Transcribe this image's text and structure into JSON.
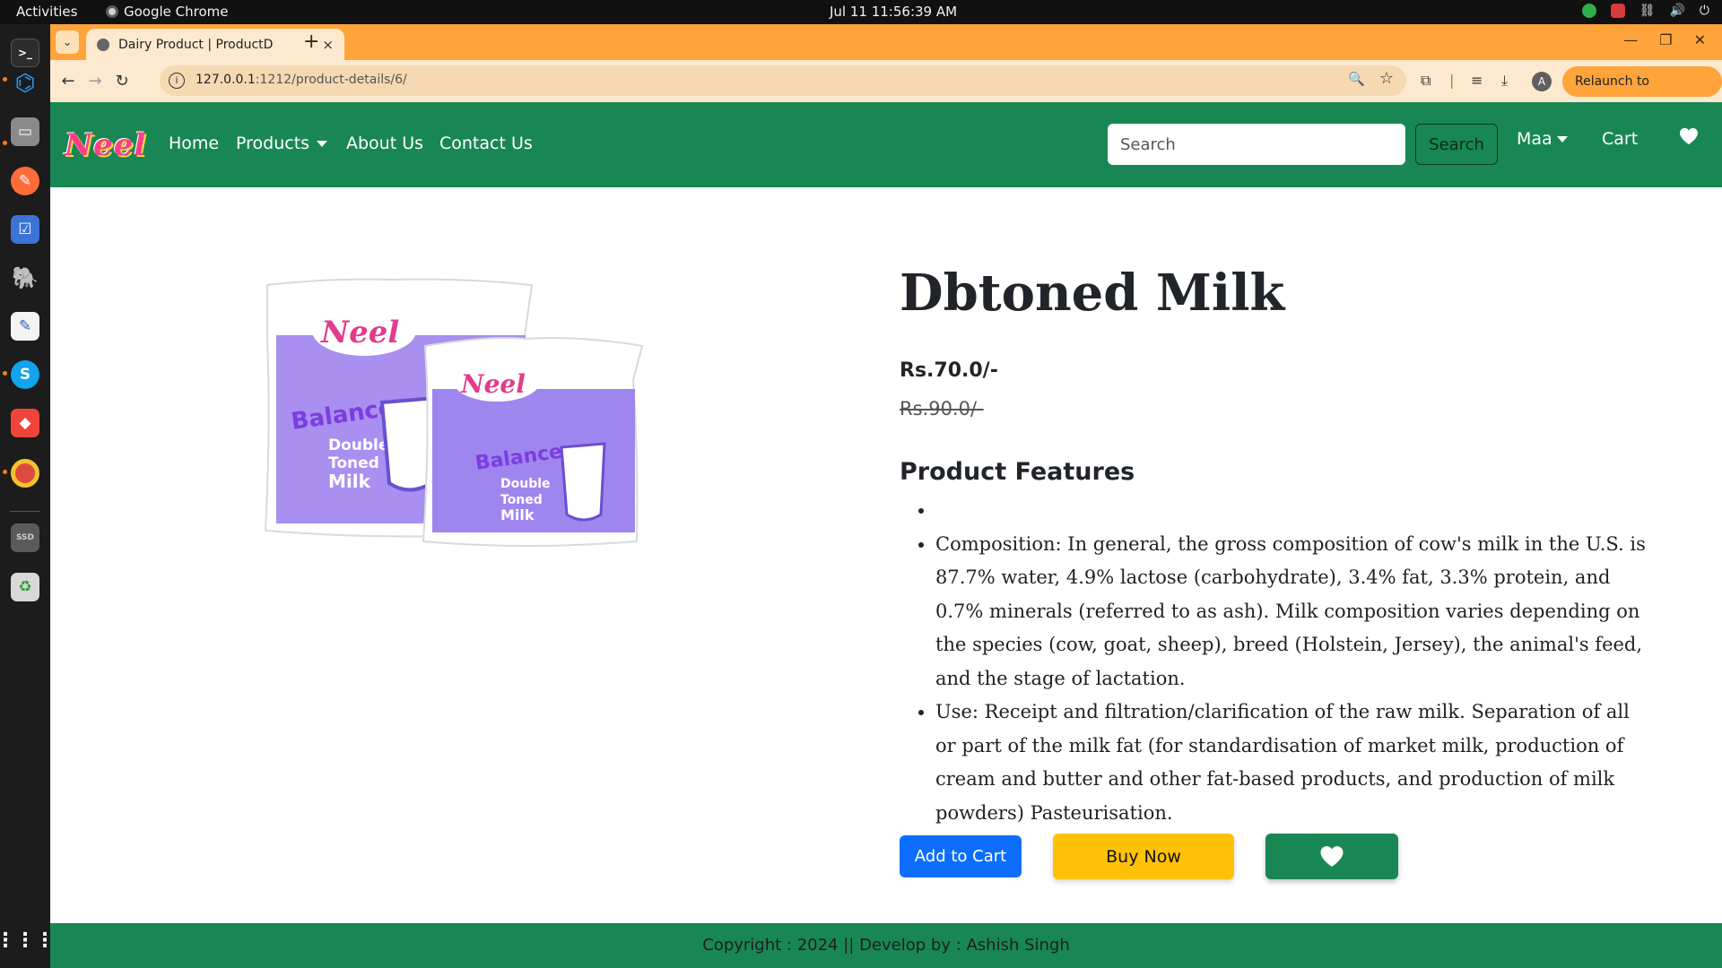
{
  "topbar": {
    "activities": "Activities",
    "app_name": "Google Chrome",
    "clock": "Jul 11  11:56:39 AM"
  },
  "dock": {
    "items": [
      "terminal",
      "vscode",
      "files",
      "postman",
      "tasks",
      "postgres",
      "text-editor",
      "skype",
      "anydesk",
      "chrome",
      "ssd",
      "trash"
    ]
  },
  "browser": {
    "tab_title": "Dairy Product | ProductD",
    "tab_close": "×",
    "new_tab": "+",
    "url_host": "127.0.0.1",
    "url_rest": ":1212/product-details/6/",
    "relaunch_label": "Relaunch to update",
    "profile_initial": "A"
  },
  "site": {
    "logo": "Neel",
    "nav": {
      "home": "Home",
      "products": "Products",
      "about": "About Us",
      "contact": "Contact Us",
      "user": "Maa",
      "cart": "Cart"
    },
    "search": {
      "placeholder": "Search",
      "button": "Search"
    }
  },
  "product": {
    "title": "Dbtoned Milk",
    "price": "Rs.70.0/-",
    "mrp": "Rs.90.0/-",
    "features_heading": "Product Features",
    "features": [
      "",
      "Composition: In general, the gross composition of cow's milk in the U.S. is 87.7% water, 4.9% lactose (carbohydrate), 3.4% fat, 3.3% protein, and 0.7% minerals (referred to as ash). Milk composition varies depending on the species (cow, goat, sheep), breed (Holstein, Jersey), the animal's feed, and the stage of lactation.",
      "Use: Receipt and filtration/clarification of the raw milk. Separation of all or part of the milk fat (for standardisation of market milk, production of cream and butter and other fat-based products, and production of milk powders) Pasteurisation."
    ],
    "packet": {
      "brand": "Neel",
      "line1": "Balance",
      "line2": "Double",
      "line3": "Toned",
      "line4": "Milk"
    },
    "add_to_cart": "Add to Cart",
    "buy_now": "Buy Now"
  },
  "footer": {
    "text": "Copyright : 2024 || Develop by : Ashish Singh"
  },
  "colors": {
    "nav_green": "#198754",
    "tab_orange": "#ffa43b",
    "primary_blue": "#0d6efd",
    "buy_yellow": "#ffc107",
    "packet_purple": "#a98ff0"
  }
}
